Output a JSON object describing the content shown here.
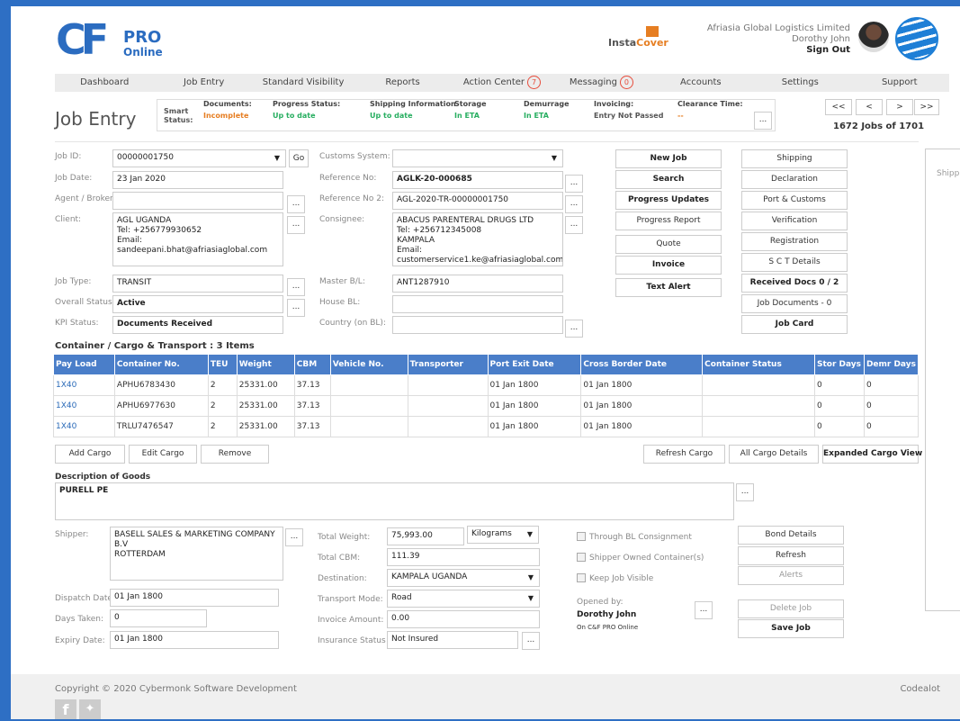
{
  "header": {
    "logo_cf": "CF",
    "logo_pro": "PRO",
    "logo_online": "Online",
    "insta": "Insta",
    "cover": "Cover",
    "company": "Afriasia Global Logistics Limited",
    "user": "Dorothy John",
    "signout": "Sign Out"
  },
  "nav": [
    {
      "label": "Dashboard",
      "badge": ""
    },
    {
      "label": "Job Entry",
      "badge": ""
    },
    {
      "label": "Standard Visibility",
      "badge": ""
    },
    {
      "label": "Reports",
      "badge": ""
    },
    {
      "label": "Action Center",
      "badge": "7"
    },
    {
      "label": "Messaging",
      "badge": "0"
    },
    {
      "label": "Accounts",
      "badge": ""
    },
    {
      "label": "Settings",
      "badge": ""
    },
    {
      "label": "Support",
      "badge": ""
    }
  ],
  "page_title": "Job Entry",
  "smart_status": {
    "label": "Smart Status:",
    "items": [
      {
        "h": "Documents:",
        "v": "Incomplete",
        "color": "#e67e22"
      },
      {
        "h": "Progress Status:",
        "v": "Up to date",
        "color": "#27ae60"
      },
      {
        "h": "Shipping Information",
        "v": "Up to date",
        "color": "#27ae60"
      },
      {
        "h": "Storage",
        "v": "In ETA",
        "color": "#27ae60"
      },
      {
        "h": "Demurrage",
        "v": "In ETA",
        "color": "#27ae60"
      },
      {
        "h": "Invoicing:",
        "v": "Entry Not Passed",
        "color": "#555"
      },
      {
        "h": "Clearance Time:",
        "v": "--",
        "color": "#e67e22"
      }
    ],
    "more": "..."
  },
  "pager": {
    "first": "<<",
    "prev": "<",
    "next": ">",
    "last": ">>",
    "count": "1672 Jobs of 1701"
  },
  "form": {
    "job_id_label": "Job ID:",
    "job_id": "00000001750",
    "go": "Go",
    "job_date_label": "Job Date:",
    "job_date": "23 Jan 2020",
    "agent_label": "Agent / Broker:",
    "agent": "",
    "client_label": "Client:",
    "client": "AGL UGANDA\nTel: +256779930652\nEmail: sandeepani.bhat@afriasiaglobal.com",
    "job_type_label": "Job Type:",
    "job_type": "TRANSIT",
    "overall_label": "Overall Status:",
    "overall": "Active",
    "kpi_label": "KPI Status:",
    "kpi": "Documents Received",
    "customs_label": "Customs System:",
    "customs": "",
    "ref_label": "Reference No:",
    "ref": "AGLK-20-000685",
    "ref2_label": "Reference No 2:",
    "ref2": "AGL-2020-TR-00000001750",
    "consignee_label": "Consignee:",
    "consignee": "ABACUS PARENTERAL DRUGS LTD\nTel: +256712345008\nKAMPALA\nEmail: customerservice1.ke@afriasiaglobal.com",
    "master_label": "Master B/L:",
    "master": "ANT1287910",
    "house_label": "House BL:",
    "house": "",
    "country_label": "Country (on BL):",
    "country": "",
    "dots": "..."
  },
  "actions_mid": [
    "New Job",
    "Search",
    "Progress Updates",
    "Progress Report",
    "Quote",
    "Invoice",
    "Text Alert"
  ],
  "actions_right": [
    "Shipping",
    "Declaration",
    "Port & Customs",
    "Verification",
    "Registration",
    "S C T Details",
    "Received Docs 0 / 2",
    "Job Documents - 0",
    "Job Card"
  ],
  "side_panel_label": "Shipp",
  "cargo": {
    "title": "Container / Cargo & Transport : 3 Items",
    "headers": [
      "Pay Load",
      "Container No.",
      "TEU",
      "Weight",
      "CBM",
      "Vehicle No.",
      "Transporter",
      "Port Exit Date",
      "Cross Border Date",
      "Container Status",
      "Stor Days",
      "Demr Days"
    ],
    "rows": [
      [
        "1X40",
        "APHU6783430",
        "2",
        "25331.00",
        "37.13",
        "",
        "",
        "01 Jan 1800",
        "01 Jan 1800",
        "",
        "0",
        "0"
      ],
      [
        "1X40",
        "APHU6977630",
        "2",
        "25331.00",
        "37.13",
        "",
        "",
        "01 Jan 1800",
        "01 Jan 1800",
        "",
        "0",
        "0"
      ],
      [
        "1X40",
        "TRLU7476547",
        "2",
        "25331.00",
        "37.13",
        "",
        "",
        "01 Jan 1800",
        "01 Jan 1800",
        "",
        "0",
        "0"
      ]
    ],
    "add": "Add Cargo",
    "edit": "Edit Cargo",
    "remove": "Remove",
    "refresh": "Refresh Cargo",
    "all": "All Cargo Details",
    "expanded": "Expanded Cargo View"
  },
  "goods": {
    "label": "Description of Goods",
    "value": "PURELL PE"
  },
  "lower": {
    "shipper_label": "Shipper:",
    "shipper": "BASELL SALES & MARKETING COMPANY B.V\nROTTERDAM",
    "dispatch_label": "Dispatch Date:",
    "dispatch": "01 Jan 1800",
    "days_label": "Days Taken:",
    "days": "0",
    "expiry_label": "Expiry Date:",
    "expiry": "01 Jan 1800",
    "weight_label": "Total Weight:",
    "weight": "75,993.00",
    "weight_unit": "Kilograms",
    "cbm_label": "Total CBM:",
    "cbm": "111.39",
    "dest_label": "Destination:",
    "dest": "KAMPALA UGANDA",
    "mode_label": "Transport Mode:",
    "mode": "Road",
    "inv_label": "Invoice Amount:",
    "inv": "0.00",
    "ins_label": "Insurance Status :",
    "ins": "Not Insured",
    "cb1": "Through BL Consignment",
    "cb2": "Shipper Owned Container(s)",
    "cb3": "Keep Job Visible",
    "opened_label": "Opened by:",
    "opened_name": "Dorothy John",
    "opened_on": "On C&F PRO Online",
    "bond": "Bond Details",
    "refresh": "Refresh",
    "alerts": "Alerts",
    "delete": "Delete Job",
    "save": "Save Job"
  },
  "footer": {
    "copyright": "Copyright © 2020 Cybermonk Software Development",
    "right": "Codealot"
  }
}
